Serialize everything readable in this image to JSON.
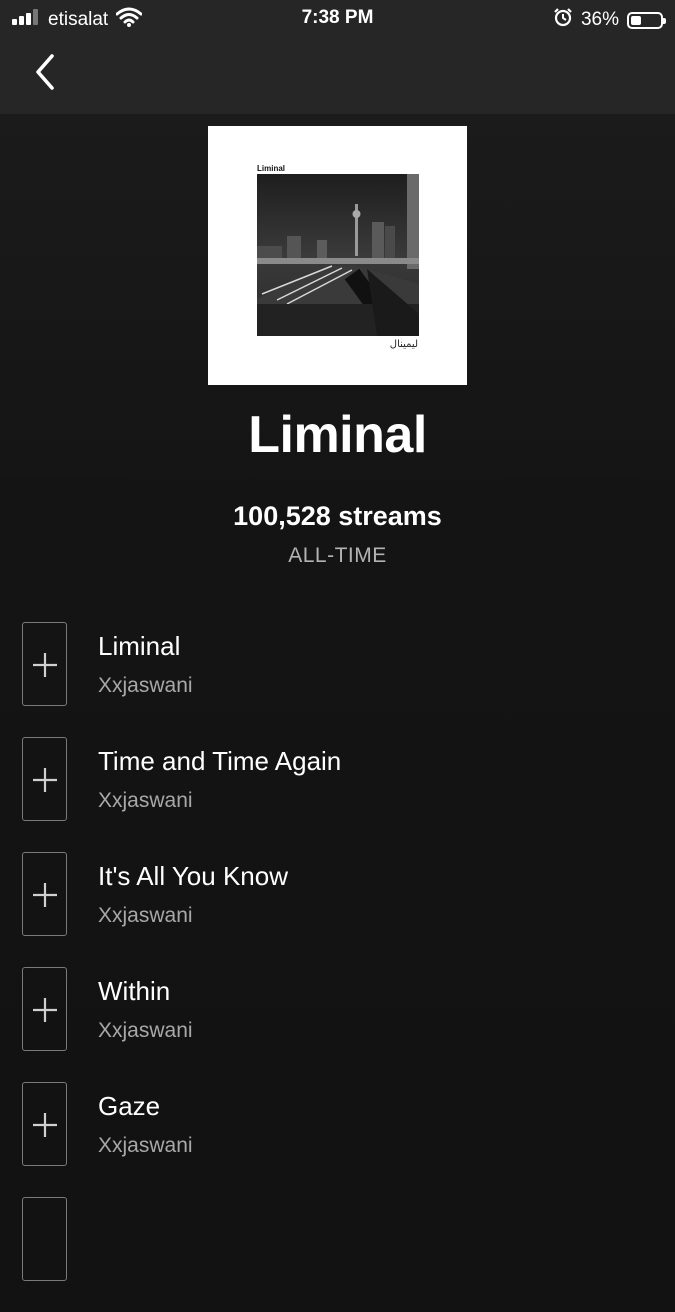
{
  "status_bar": {
    "carrier": "etisalat",
    "time": "7:38 PM",
    "battery": "36%",
    "battery_level": 0.36,
    "icons": [
      "signal-icon",
      "wifi-icon",
      "alarm-icon",
      "battery-icon"
    ]
  },
  "nav": {
    "back_icon": "chevron-left-icon"
  },
  "album": {
    "cover_title": "Liminal",
    "cover_arabic": "ليمينال",
    "title": "Liminal",
    "streams": "100,528 streams",
    "period": "ALL-TIME"
  },
  "tracks": [
    {
      "name": "Liminal",
      "artist": "Xxjaswani"
    },
    {
      "name": "Time and Time Again",
      "artist": "Xxjaswani"
    },
    {
      "name": "It's All You Know",
      "artist": "Xxjaswani"
    },
    {
      "name": "Within",
      "artist": "Xxjaswani"
    },
    {
      "name": "Gaze",
      "artist": "Xxjaswani"
    }
  ],
  "colors": {
    "background": "#121212",
    "header": "#262626",
    "text": "#ffffff",
    "secondary_text": "#a8a8a8"
  }
}
